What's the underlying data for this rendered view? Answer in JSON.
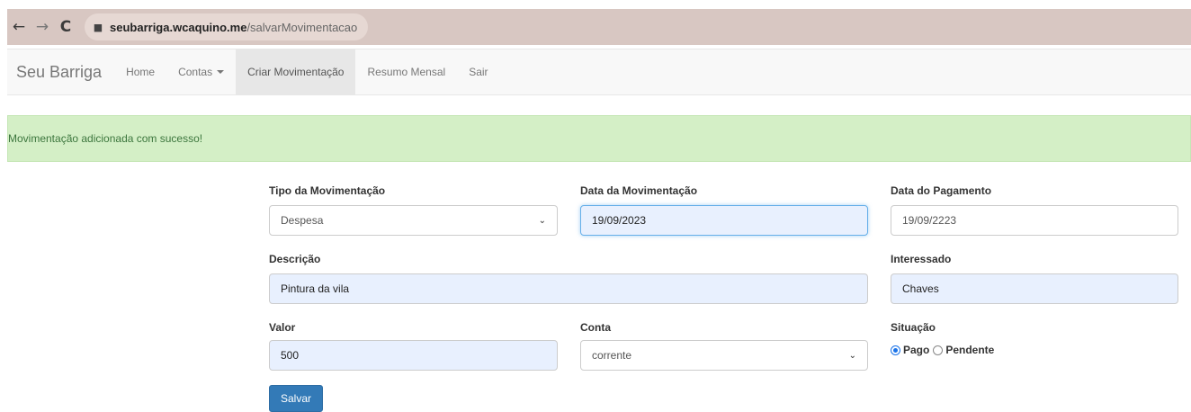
{
  "browser": {
    "back_icon": "←",
    "forward_icon": "→",
    "reload_icon": "C",
    "lock_icon": "🔒",
    "url_host": "seubarriga.wcaquino.me",
    "url_path": "/salvarMovimentacao"
  },
  "navbar": {
    "brand": "Seu Barriga",
    "items": [
      {
        "label": "Home"
      },
      {
        "label": "Contas"
      },
      {
        "label": "Criar Movimentação"
      },
      {
        "label": "Resumo Mensal"
      },
      {
        "label": "Sair"
      }
    ]
  },
  "alert": {
    "message": "Movimentação adicionada com sucesso!",
    "color": "#d4efc6"
  },
  "form": {
    "tipo_label": "Tipo da Movimentação",
    "tipo_value": "Despesa",
    "data_mov_label": "Data da Movimentação",
    "data_mov_value": "19/09/2023",
    "data_pag_label": "Data do Pagamento",
    "data_pag_value": "19/09/2223",
    "descricao_label": "Descrição",
    "descricao_value": "Pintura da vila",
    "interessado_label": "Interessado",
    "interessado_value": "Chaves",
    "valor_label": "Valor",
    "valor_value": "500",
    "conta_label": "Conta",
    "conta_value": "corrente",
    "situacao_label": "Situação",
    "situacao_options": [
      "Pago",
      "Pendente"
    ],
    "situacao_selected": "Pago",
    "submit_label": "Salvar",
    "chevron_icon": "⌄"
  }
}
